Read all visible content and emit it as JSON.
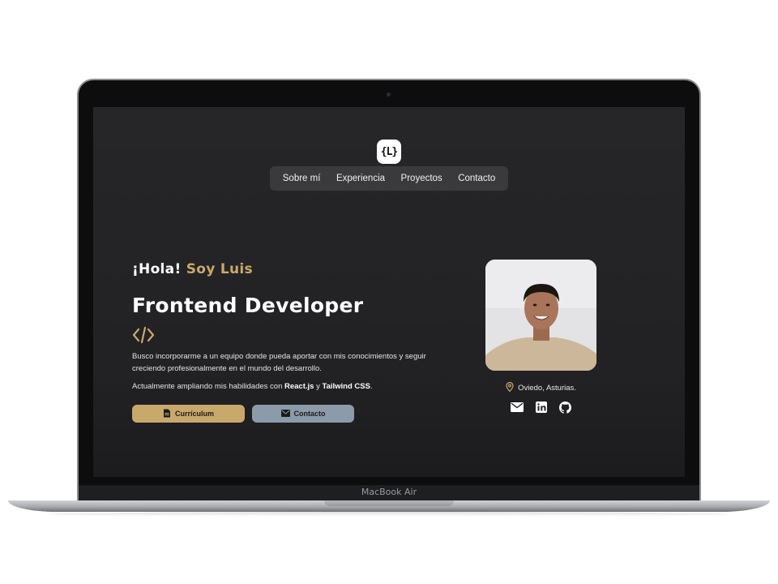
{
  "device": {
    "model_label": "MacBook Air"
  },
  "site": {
    "logo_text": "{L}",
    "nav": [
      {
        "label": "Sobre mí"
      },
      {
        "label": "Experiencia"
      },
      {
        "label": "Proyectos"
      },
      {
        "label": "Contacto"
      }
    ]
  },
  "hero": {
    "greeting_prefix": "¡Hola!",
    "greeting_name": "Soy Luis",
    "role": "Frontend Developer",
    "description": "Busco incorporarme a un equipo donde pueda aportar con mis conocimientos y seguir creciendo profesionalmente en el mundo del desarrollo.",
    "learning_prefix": "Actualmente ampliando mis habilidades con ",
    "learning_tech_1": "React.js",
    "learning_joiner": " y ",
    "learning_tech_2": "Tailwind CSS",
    "learning_suffix": ".",
    "buttons": {
      "cv_label": "Currículum",
      "contact_label": "Contacto"
    }
  },
  "profile": {
    "location": "Oviedo, Asturias.",
    "socials": [
      "mail-icon",
      "linkedin-icon",
      "github-icon"
    ]
  },
  "colors": {
    "accent": "#c9a96b",
    "secondary_button": "#8c9baa",
    "screen_bg": "#252527",
    "nav_bg": "#3a3a3d"
  }
}
